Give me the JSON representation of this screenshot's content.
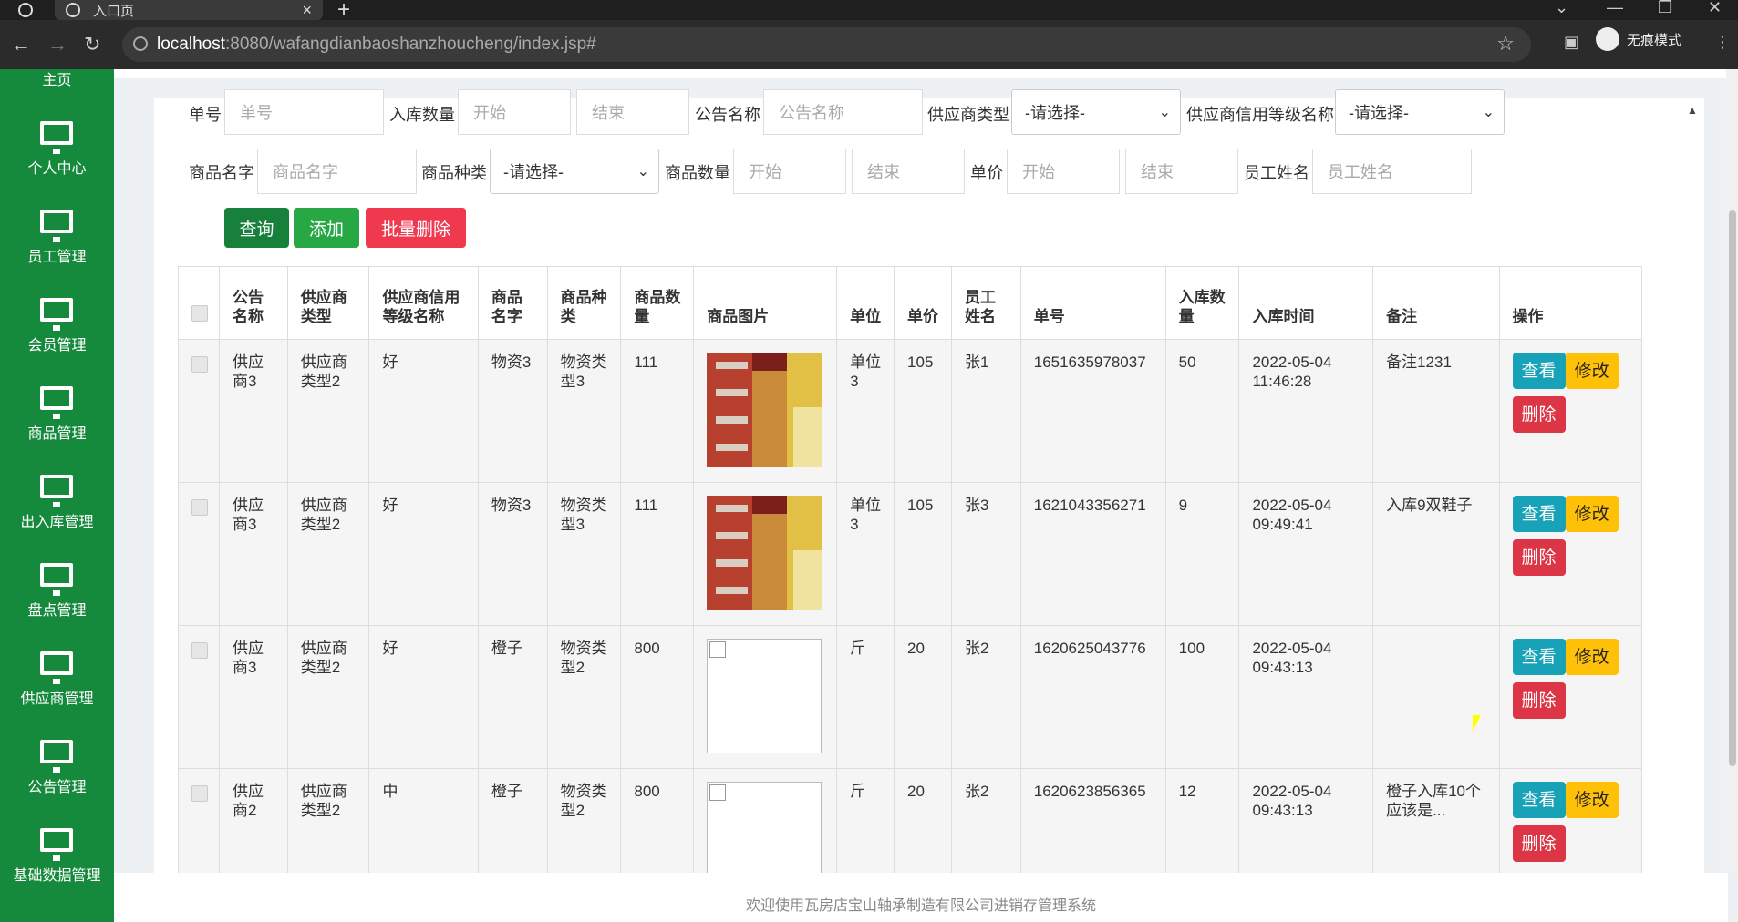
{
  "browser": {
    "tab_title": "入口页",
    "url_host": "localhost",
    "url_rest": ":8080/wafangdianbaoshanzhoucheng/index.jsp#",
    "incognito_label": "无痕模式"
  },
  "sidebar": {
    "items": [
      {
        "label": "主页"
      },
      {
        "label": "个人中心"
      },
      {
        "label": "员工管理"
      },
      {
        "label": "会员管理"
      },
      {
        "label": "商品管理"
      },
      {
        "label": "出入库管理"
      },
      {
        "label": "盘点管理"
      },
      {
        "label": "供应商管理"
      },
      {
        "label": "公告管理"
      },
      {
        "label": "基础数据管理"
      }
    ]
  },
  "filters": {
    "order_no_label": "单号",
    "order_no_placeholder": "单号",
    "in_qty_label": "入库数量",
    "start": "开始",
    "end": "结束",
    "notice_label": "公告名称",
    "notice_placeholder": "公告名称",
    "supplier_type_label": "供应商类型",
    "select_default": "-请选择-",
    "credit_label": "供应商信用等级名称",
    "goods_name_label": "商品名字",
    "goods_name_placeholder": "商品名字",
    "goods_type_label": "商品种类",
    "goods_qty_label": "商品数量",
    "price_label": "单价",
    "staff_label": "员工姓名",
    "staff_placeholder": "员工姓名"
  },
  "actions": {
    "query": "查询",
    "add": "添加",
    "batch_delete": "批量删除"
  },
  "table": {
    "headers": [
      "公告名称",
      "供应商类型",
      "供应商信用等级名称",
      "商品名字",
      "商品种类",
      "商品数量",
      "商品图片",
      "单位",
      "单价",
      "员工姓名",
      "单号",
      "入库数量",
      "入库时间",
      "备注",
      "操作"
    ],
    "rows": [
      {
        "notice": "供应商3",
        "stype": "供应商类型2",
        "credit": "好",
        "gname": "物资3",
        "gtype": "物资类型3",
        "gqty": "111",
        "image": "photo",
        "unit": "单位3",
        "price": "105",
        "staff": "张1",
        "order": "1651635978037",
        "inqty": "50",
        "time": "2022-05-04 11:46:28",
        "remark": "备注1231"
      },
      {
        "notice": "供应商3",
        "stype": "供应商类型2",
        "credit": "好",
        "gname": "物资3",
        "gtype": "物资类型3",
        "gqty": "111",
        "image": "photo",
        "unit": "单位3",
        "price": "105",
        "staff": "张3",
        "order": "1621043356271",
        "inqty": "9",
        "time": "2022-05-04 09:49:41",
        "remark": "入库9双鞋子"
      },
      {
        "notice": "供应商3",
        "stype": "供应商类型2",
        "credit": "好",
        "gname": "橙子",
        "gtype": "物资类型2",
        "gqty": "800",
        "image": "broken",
        "unit": "斤",
        "price": "20",
        "staff": "张2",
        "order": "1620625043776",
        "inqty": "100",
        "time": "2022-05-04 09:43:13",
        "remark": ""
      },
      {
        "notice": "供应商2",
        "stype": "供应商类型2",
        "credit": "中",
        "gname": "橙子",
        "gtype": "物资类型2",
        "gqty": "800",
        "image": "broken",
        "unit": "斤",
        "price": "20",
        "staff": "张2",
        "order": "1620623856365",
        "inqty": "12",
        "time": "2022-05-04 09:43:13",
        "remark": "橙子入库10个应该是..."
      }
    ],
    "row_actions": {
      "view": "查看",
      "edit": "修改",
      "delete": "删除"
    }
  },
  "footer": "欢迎使用瓦房店宝山轴承制造有限公司进销存管理系统",
  "colors": {
    "sidebar": "#168a3c",
    "query": "#17803b",
    "add": "#28a745",
    "danger": "#dc3545",
    "info": "#17a2b8",
    "warning": "#ffc107"
  }
}
